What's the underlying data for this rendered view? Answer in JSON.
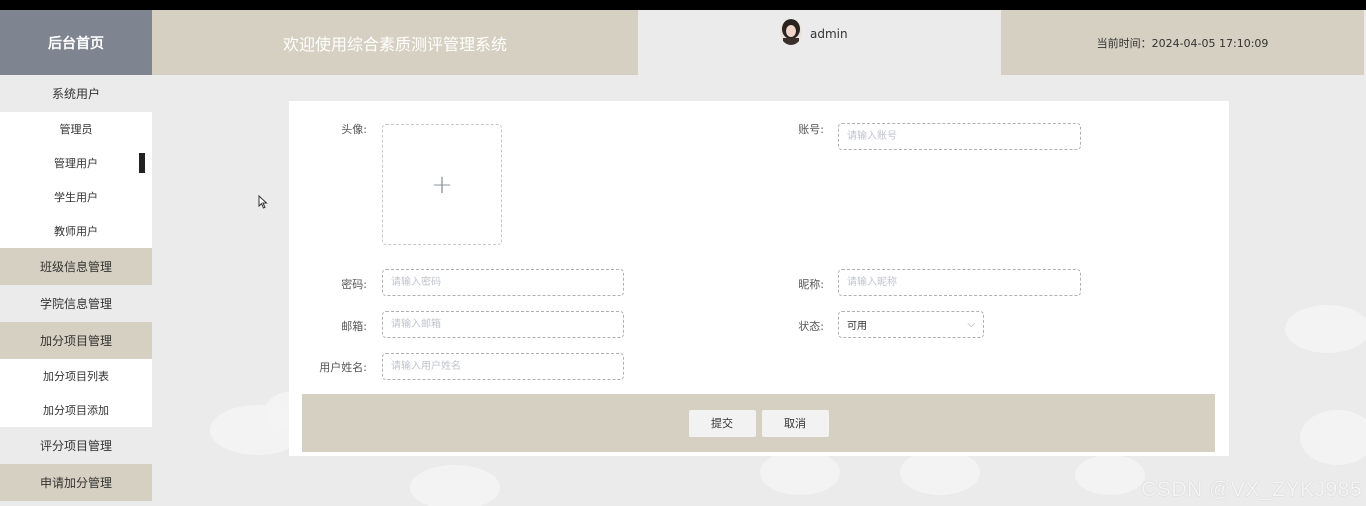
{
  "header": {
    "logo_text": "后台首页",
    "system_title": "欢迎使用综合素质测评管理系统",
    "username": "admin",
    "current_time": "当前时间：2024-04-05 17:10:09"
  },
  "sidebar": {
    "items": [
      {
        "label": "系统用户",
        "type": "category"
      },
      {
        "label": "管理员",
        "type": "sub"
      },
      {
        "label": "管理用户",
        "type": "sub",
        "active": true
      },
      {
        "label": "学生用户",
        "type": "sub"
      },
      {
        "label": "教师用户",
        "type": "sub"
      },
      {
        "label": "班级信息管理",
        "type": "category"
      },
      {
        "label": "学院信息管理",
        "type": "category"
      },
      {
        "label": "加分项目管理",
        "type": "category"
      },
      {
        "label": "加分项目列表",
        "type": "sub"
      },
      {
        "label": "加分项目添加",
        "type": "sub"
      },
      {
        "label": "评分项目管理",
        "type": "category"
      },
      {
        "label": "申请加分管理",
        "type": "category"
      }
    ]
  },
  "form": {
    "avatar_label": "头像:",
    "upload_icon": "+",
    "account_label": "账号:",
    "account_placeholder": "请输入账号",
    "password_label": "密码:",
    "password_placeholder": "请输入密码",
    "nickname_label": "昵称:",
    "nickname_placeholder": "请输入昵称",
    "email_label": "邮箱:",
    "email_placeholder": "请输入邮箱",
    "status_label": "状态:",
    "status_value": "可用",
    "realname_label": "用户姓名:",
    "realname_placeholder": "请输入用户姓名",
    "submit_label": "提交",
    "cancel_label": "取消"
  },
  "watermark": "CSDN @VX_ZYKJ985",
  "colors": {
    "logo_bg": "#7e8590",
    "header_beige": "#d6d0c2",
    "page_bg": "#ebebeb",
    "card_bg": "#ffffff"
  }
}
